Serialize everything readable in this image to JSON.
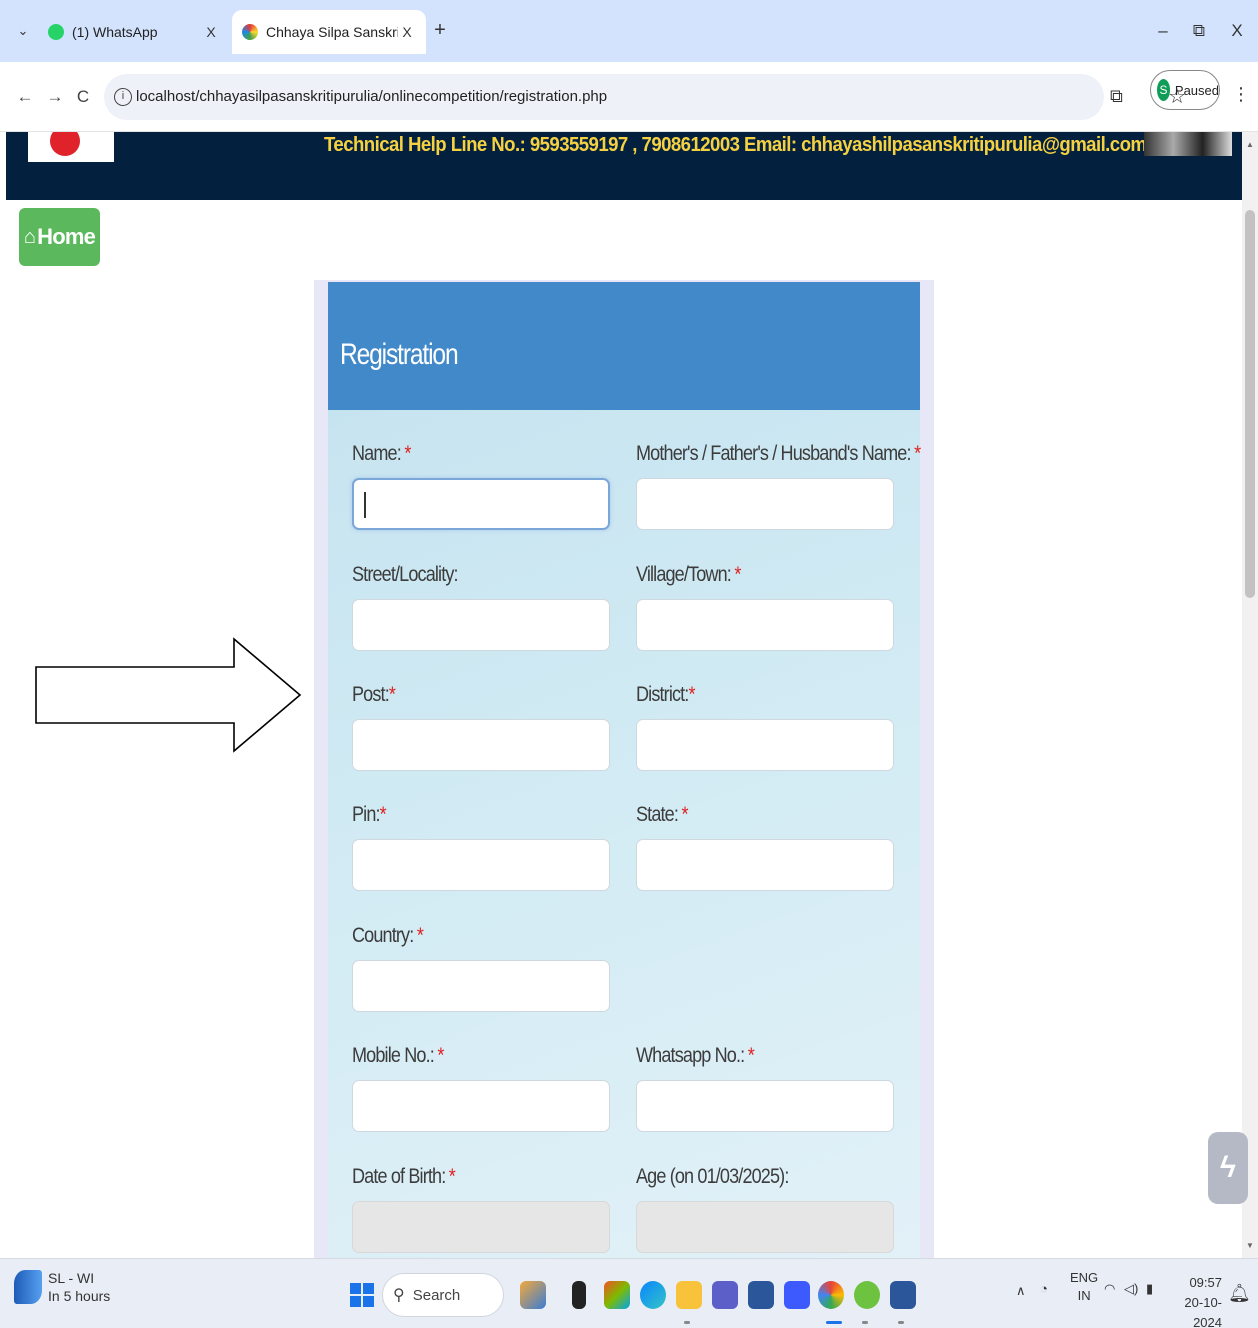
{
  "browser": {
    "tabs": [
      {
        "title": "(1) WhatsApp",
        "close": "X",
        "active": false
      },
      {
        "title": "Chhaya Silpa Sanskriti, Purulia",
        "close": "X",
        "active": true
      }
    ],
    "new_tab": "+",
    "window_controls": {
      "minimize": "–",
      "restore": "⧉",
      "close": "X"
    },
    "nav": {
      "back": "←",
      "forward": "→",
      "reload": "C"
    },
    "url": "localhost/chhayasilpasanskritipurulia/onlinecompetition/registration.php",
    "profile_initial": "S",
    "profile_status": "Paused"
  },
  "page": {
    "helpline": "Technical Help Line No.: 9593559197 , 7908612003 Email: chhayashilpasanskritipurulia@gmail.com",
    "home_label": "Home",
    "form": {
      "title": "Registration",
      "fields": {
        "name": {
          "label": "Name:",
          "required": "*"
        },
        "guardian_name": {
          "label": "Mother's / Father's / Husband's Name:",
          "required": "*"
        },
        "street": {
          "label": "Street/Locality:",
          "required": ""
        },
        "village": {
          "label": "Village/Town:",
          "required": "*"
        },
        "post": {
          "label": "Post:",
          "required": "*"
        },
        "district": {
          "label": "District:",
          "required": "*"
        },
        "pin": {
          "label": "Pin:",
          "required": "*"
        },
        "state": {
          "label": "State:",
          "required": "*"
        },
        "country": {
          "label": "Country:",
          "required": "*"
        },
        "mobile": {
          "label": "Mobile No.:",
          "required": "*"
        },
        "whatsapp": {
          "label": "Whatsapp No.:",
          "required": "*"
        },
        "dob": {
          "label": "Date of Birth:",
          "required": "*"
        },
        "age": {
          "label": "Age (on 01/03/2025):",
          "required": ""
        }
      }
    }
  },
  "taskbar": {
    "weather_title": "SL - WI",
    "weather_sub": "In 5 hours",
    "search_label": "Search",
    "lang_top": "ENG",
    "lang_bottom": "IN",
    "time": "09:57",
    "date": "20-10-2024"
  },
  "colors": {
    "tabbar": "#d3e3fd",
    "header_strip": "#03203f",
    "helpline_text": "#f5d142",
    "home_button": "#5cb85c",
    "form_header": "#4289c9",
    "required_star": "#e02020"
  }
}
